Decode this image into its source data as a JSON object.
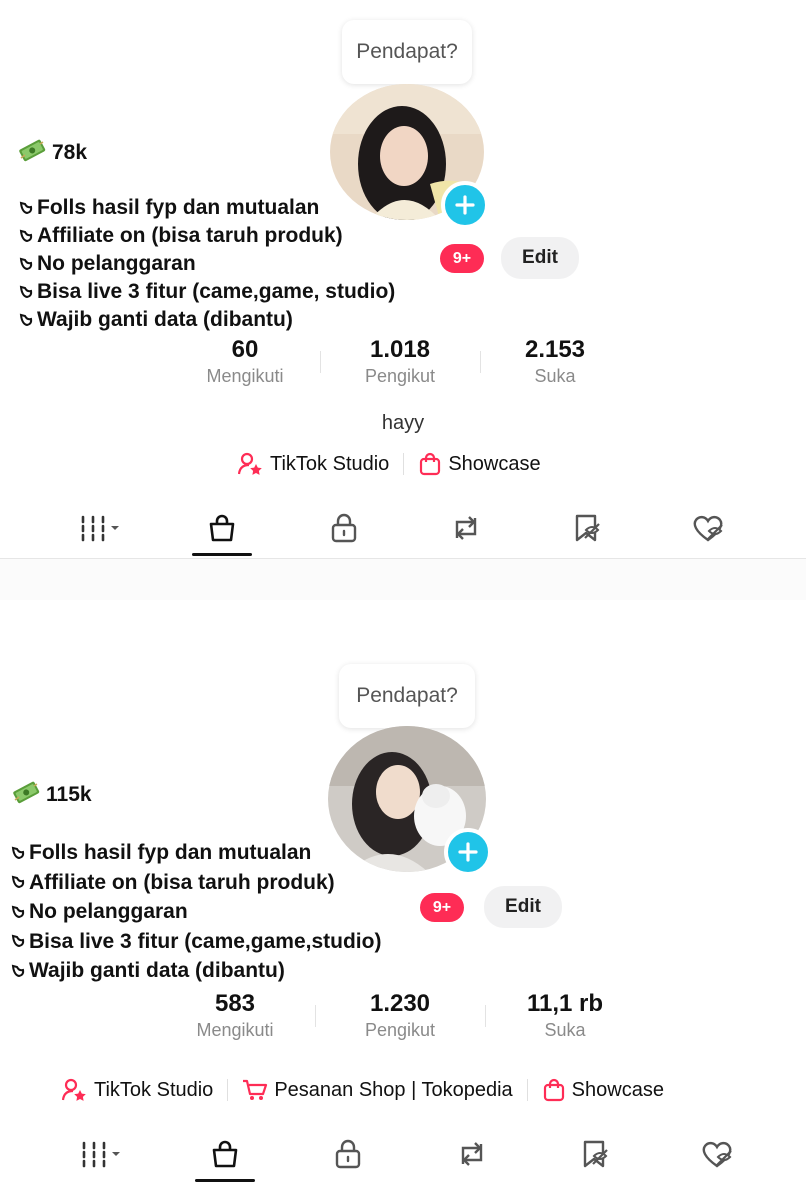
{
  "panels": [
    {
      "tooltip": "Pendapat?",
      "price": "78k",
      "bullets": [
        "Folls hasil fyp dan mutualan",
        "Affiliate on (bisa taruh produk)",
        "No pelanggaran",
        "Bisa live 3 fitur (came,game, studio)",
        "Wajib ganti data (dibantu)"
      ],
      "badge": "9+",
      "edit_label": "Edit",
      "stats": [
        {
          "value": "60",
          "label": "Mengikuti"
        },
        {
          "value": "1.018",
          "label": "Pengikut"
        },
        {
          "value": "2.153",
          "label": "Suka"
        }
      ],
      "bio": "hayy",
      "links": [
        "TikTok Studio",
        "Showcase"
      ]
    },
    {
      "tooltip": "Pendapat?",
      "price": "115k",
      "bullets": [
        "Folls hasil fyp dan mutualan",
        "Affiliate on (bisa taruh produk)",
        "No pelanggaran",
        "Bisa live 3 fitur (came,game,studio)",
        "Wajib ganti data (dibantu)"
      ],
      "badge": "9+",
      "edit_label": "Edit",
      "stats": [
        {
          "value": "583",
          "label": "Mengikuti"
        },
        {
          "value": "1.230",
          "label": "Pengikut"
        },
        {
          "value": "11,1 rb",
          "label": "Suka"
        }
      ],
      "links": [
        "TikTok Studio",
        "Pesanan Shop | Tokopedia",
        "Showcase"
      ]
    }
  ],
  "tabs": [
    "videos-grid-icon",
    "shop-bag-icon",
    "lock-icon",
    "repost-icon",
    "favorites-icon",
    "liked-icon"
  ],
  "colors": {
    "accent": "#fe2c55",
    "plus": "#20c4e8",
    "muted": "#8a8a8a"
  }
}
